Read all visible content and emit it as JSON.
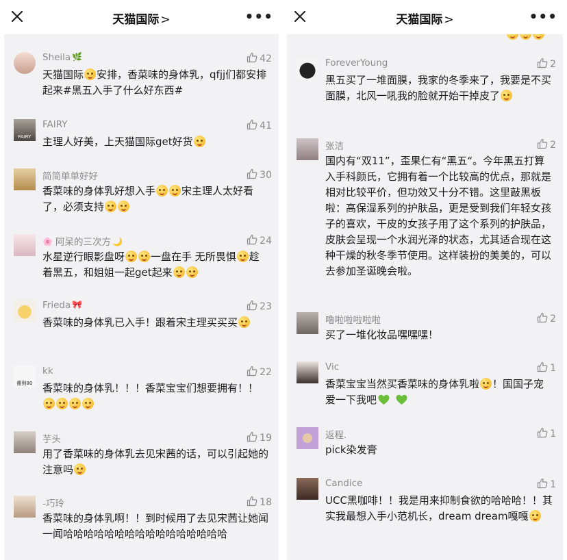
{
  "header": {
    "title": "天猫国际",
    "chevron": ">",
    "more": "•••"
  },
  "left_comments": [
    {
      "user": "Sheila",
      "likes": "42",
      "text": "天猫国际[emoji]安排，香菜味的身体乳，qfjj们都安排起来#黑五入手了什么好东西#"
    },
    {
      "user": "FAIRY",
      "likes": "41",
      "text": "主理人好美，上天猫国际get好货[emoji]"
    },
    {
      "user": "简简单单好好",
      "likes": "30",
      "text": "香菜味的身体乳好想入手[emoji][emoji]宋主理人太好看了，必须支持[emoji][emoji]"
    },
    {
      "user": "阿呆的三次方",
      "likes": "24",
      "text": "水星逆行眼影盘呀[emoji][emoji]一盘在手 无所畏惧[emoji]趁着黑五，和姐姐一起get起来[emoji][emoji]"
    },
    {
      "user": "Frieda",
      "likes": "23",
      "text": "香菜味的身体乳已入手！跟着宋主理买买买[emoji]"
    },
    {
      "user": "kk",
      "likes": "22",
      "text": "香菜味的身体乳！！！香菜宝宝们想要拥有！！[emoji][emoji][emoji][emoji]"
    },
    {
      "user": "芋头",
      "likes": "19",
      "text": "用了香菜味的身体乳去见宋茜的话，可以引起她的注意吗[emoji]"
    },
    {
      "user": "-巧玲",
      "likes": "18",
      "text": "香菜味的身体乳啊！！到时候用了去见宋茜让她闻一闻哈哈哈哈哈哈哈哈哈哈哈哈哈哈哈哈"
    }
  ],
  "right_comments": [
    {
      "user": "ForeverYoung",
      "likes": "2",
      "text": "黑五买了一堆面膜，我家的冬季来了，我要是不买面膜，北风一吼我的脸就开始干掉皮了[emoji]"
    },
    {
      "user": "张洁",
      "likes": "2",
      "text": "国内有“双11”，歪果仁有“黑五“。今年黑五打算入手科颜氏，它拥有着一个比较高的优点，那就是相对比较平价，但功效又十分不错。这里敲黑板啦：高保湿系列的护肤品，更是受到我们年轻女孩子的喜欢，干皮的女孩子用了这个系列的护肤品，皮肤会呈现一个水润光泽的状态，尤其适合现在这种干燥的秋冬季节使用。这样装扮的美美的，可以去参加圣诞晚会啦。"
    },
    {
      "user": "嚕啦啦啦啦啦",
      "likes": "2",
      "text": "买了一堆化妆品嘿嘿嘿！"
    },
    {
      "user": "Vic",
      "likes": "1",
      "text": "香菜宝宝当然买香菜味的身体乳啦[emoji]！国国子宠爱一下我吧[heart] [heart]"
    },
    {
      "user": "返程.",
      "likes": "1",
      "text": "pick染发膏"
    },
    {
      "user": "Candice",
      "likes": "1",
      "text": "UCC黑咖啡！！我是用来抑制食欲的哈哈哈！！其实我最想入手小范机长，dream dream嘎嘎[emoji]"
    }
  ],
  "avatar_labels": {
    "fairy": "FAIRY",
    "kk": "瘦到80"
  },
  "colors": {
    "background": "#f2f2f4",
    "username": "#8a8a8a",
    "text": "#1c1c1c",
    "heart": "#6bbf3a"
  }
}
